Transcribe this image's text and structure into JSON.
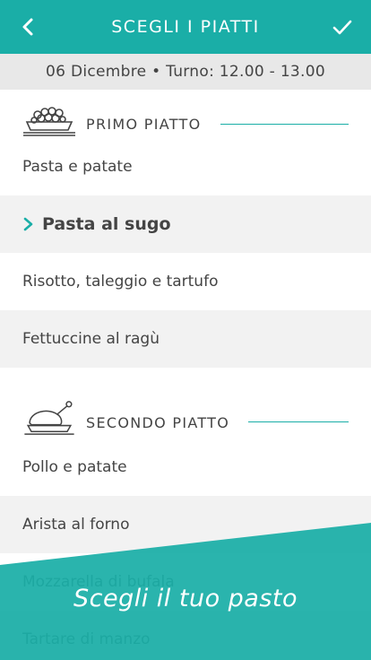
{
  "header": {
    "title": "SCEGLI I PIATTI",
    "accent": "#1aaea7",
    "back_icon": "chevron-left-icon",
    "confirm_icon": "check-icon"
  },
  "subheader": {
    "text": "06 Dicembre • Turno: 12.00 - 13.00"
  },
  "sections": [
    {
      "label": "PRIMO PIATTO",
      "icon": "pasta-dish-icon",
      "items": [
        "Pasta e patate",
        "Pasta al sugo",
        "Risotto, taleggio e tartufo",
        "Fettuccine al ragù"
      ],
      "selected": "Pasta al sugo"
    },
    {
      "label": "SECONDO PIATTO",
      "icon": "roast-chicken-icon",
      "items": [
        "Pollo e patate",
        "Arista al forno",
        "Mozzarella di bufala",
        "Tartare di manzo"
      ]
    }
  ],
  "promo": {
    "tagline": "Scegli il tuo pasto"
  }
}
